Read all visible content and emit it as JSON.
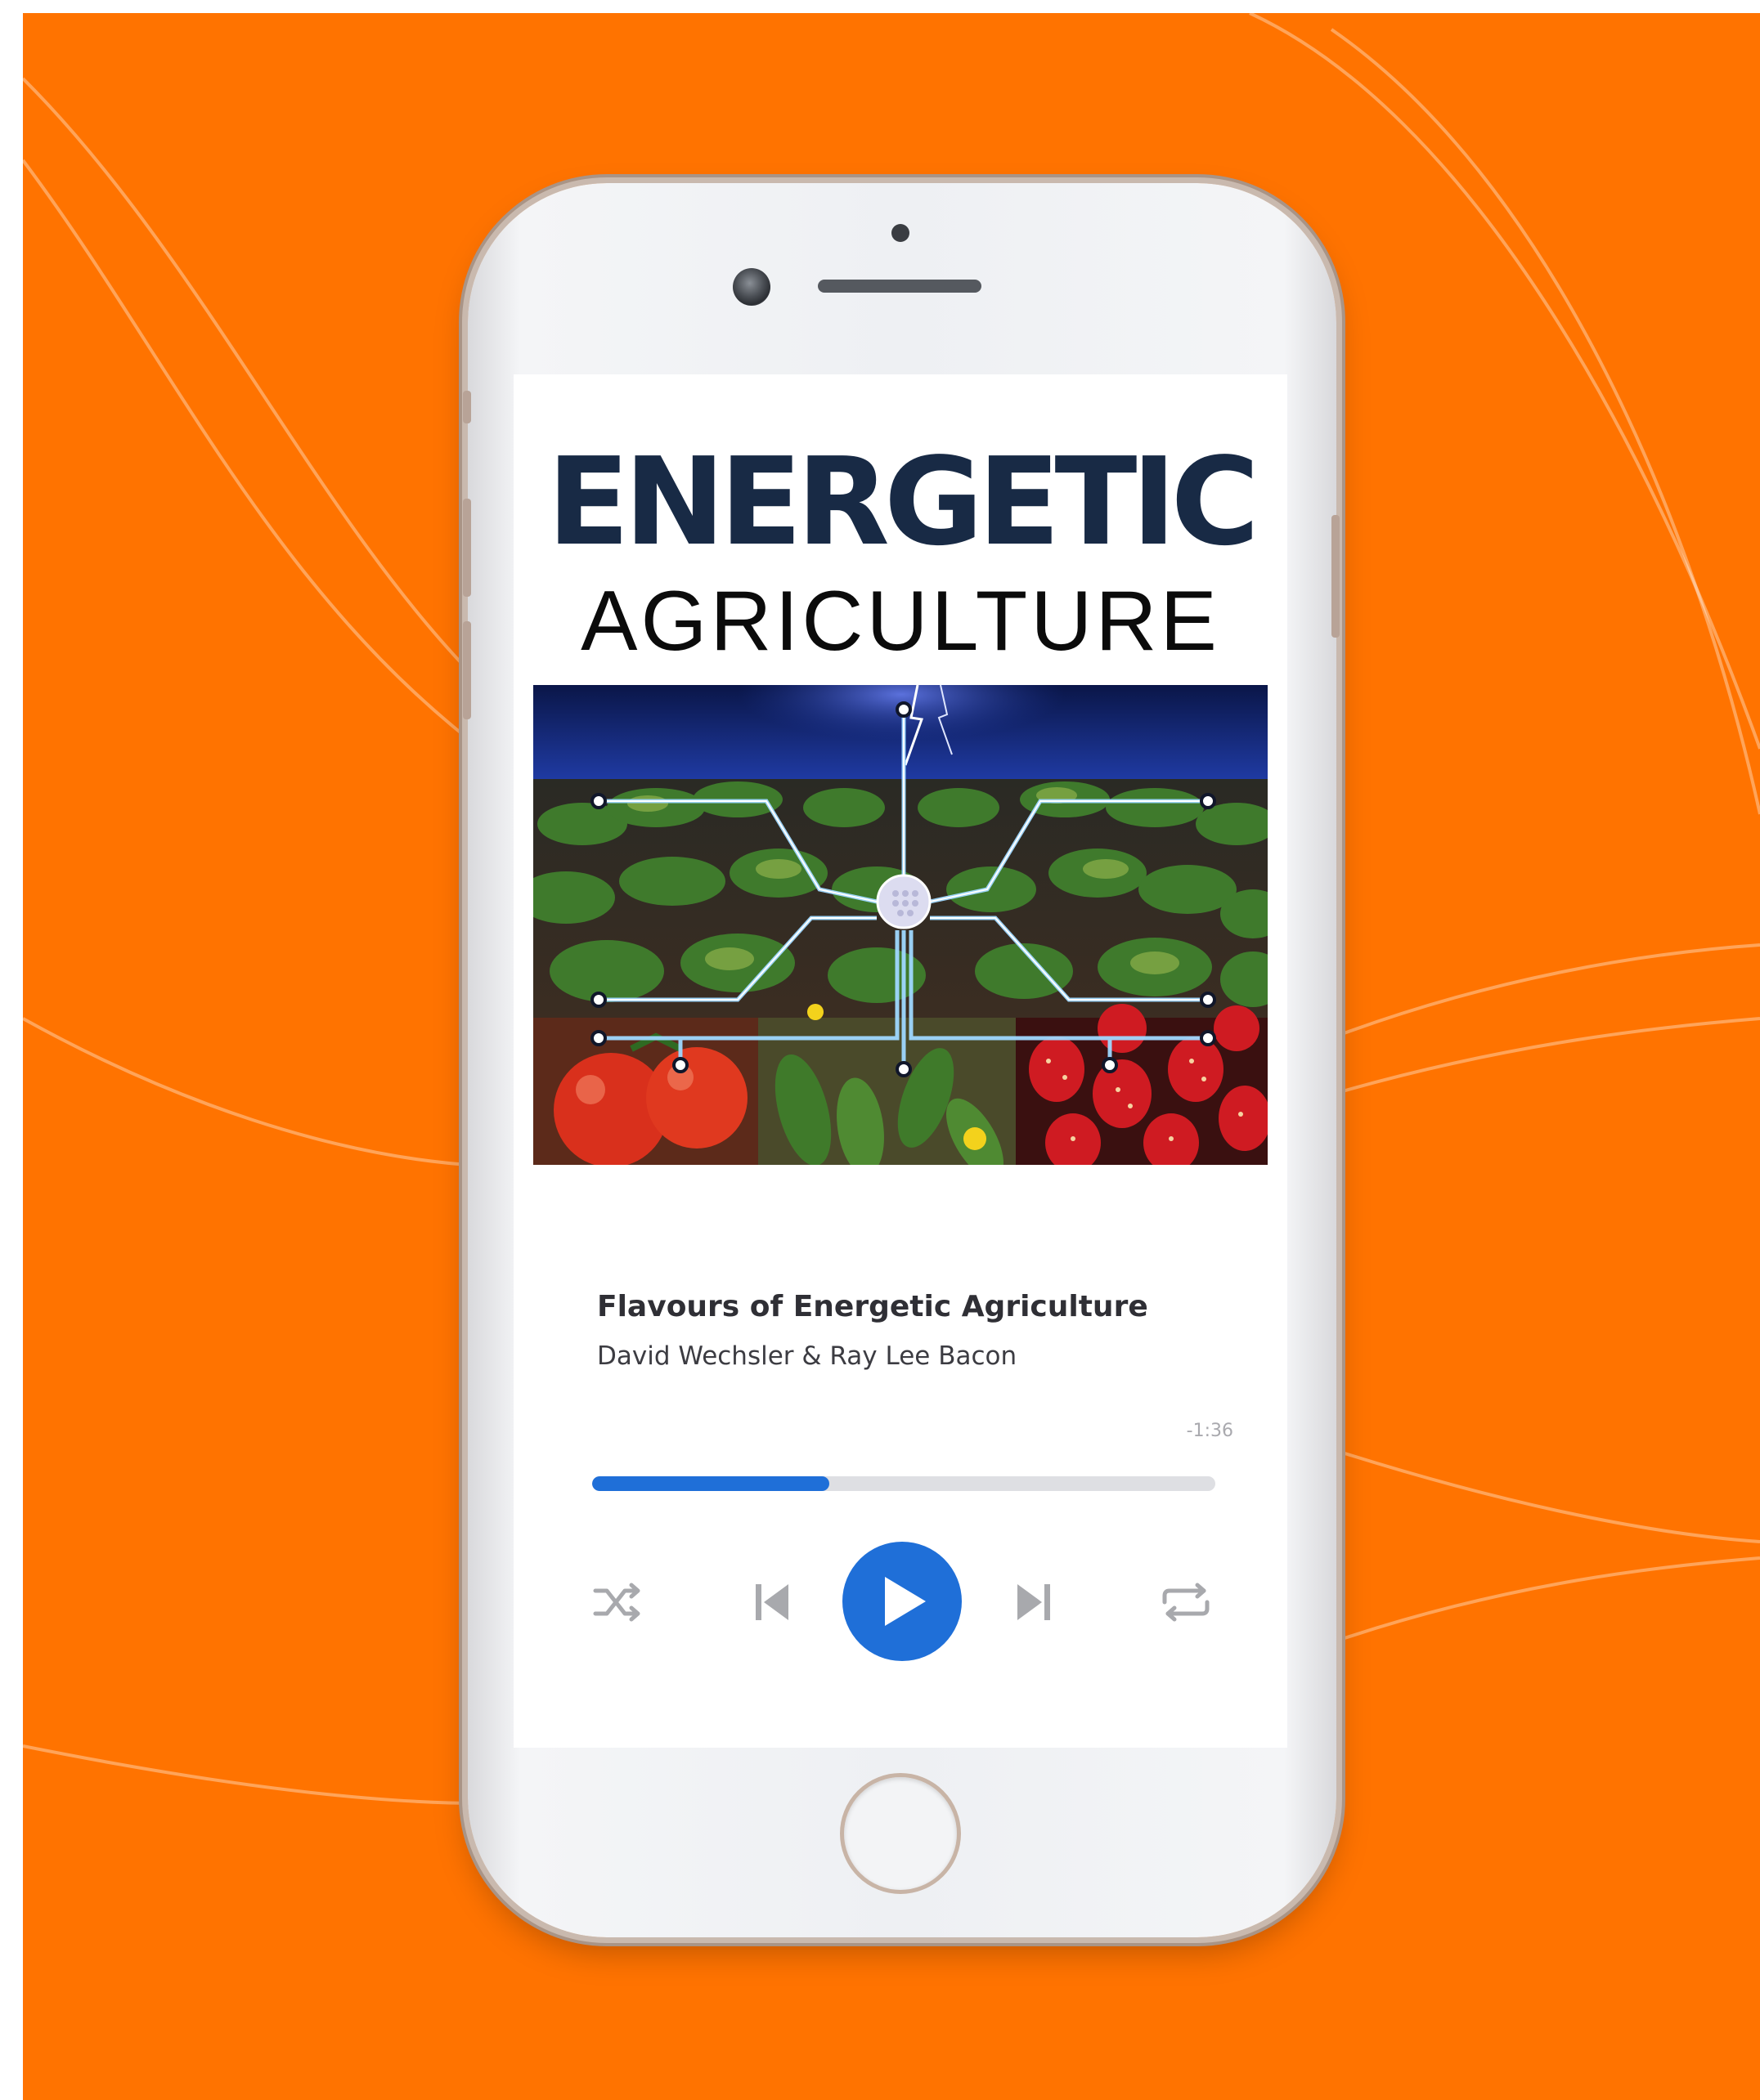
{
  "book": {
    "title_line1": "ENERGETIC",
    "title_line2": "AGRICULTURE"
  },
  "track": {
    "title": "Flavours of Energetic Agriculture",
    "artist": "David Wechsler & Ray Lee Bacon",
    "remaining_time": "-1:36",
    "progress_percent": 38
  },
  "controls": {
    "shuffle_icon": "shuffle-icon",
    "previous_icon": "skip-previous-icon",
    "play_icon": "play-icon",
    "next_icon": "skip-next-icon",
    "repeat_icon": "repeat-icon"
  },
  "colors": {
    "background": "#ff7300",
    "accent": "#1f6fd8",
    "title_dark": "#182a45",
    "progress_track": "#dedfe3",
    "control_gray": "#a8a9ad"
  }
}
